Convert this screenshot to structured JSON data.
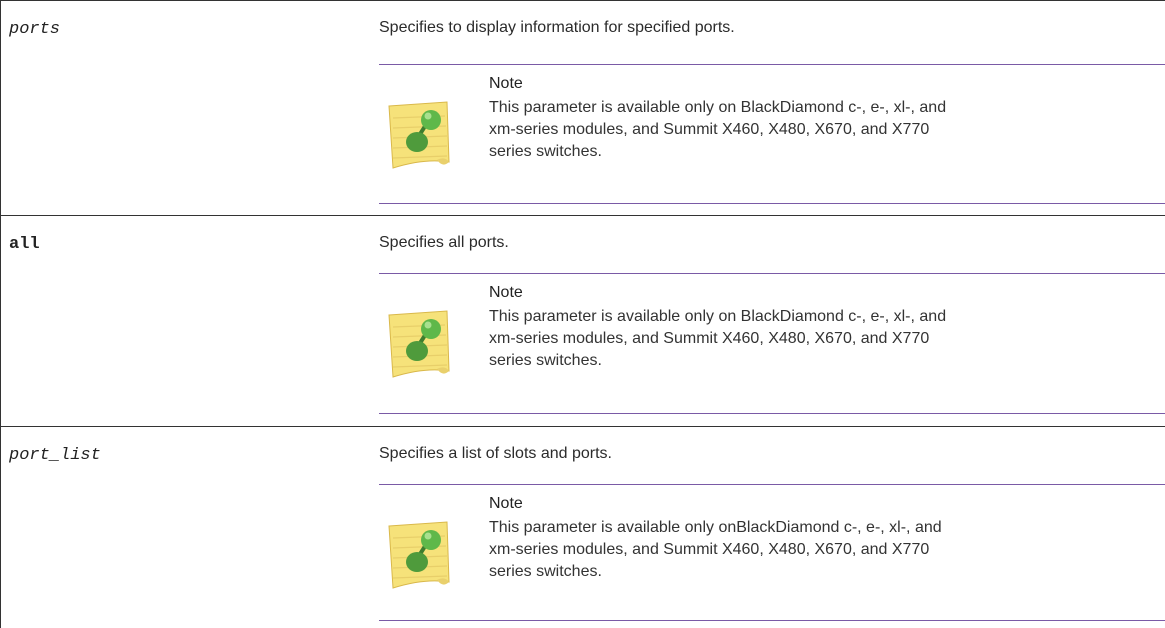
{
  "rows": [
    {
      "term": "ports",
      "description": "Specifies to display information for specified ports.",
      "note_title": "Note",
      "note_lines": [
        "This parameter is available only on BlackDiamond c-, e-, xl-, and",
        "xm-series modules, and Summit X460, X480, X670, and X770",
        "series switches."
      ]
    },
    {
      "term": "all",
      "description": "Specifies all ports.",
      "note_title": "Note",
      "note_lines": [
        "This parameter is available only on BlackDiamond c-, e-, xl-, and",
        "xm-series modules, and Summit X460, X480, X670, and X770",
        "series switches."
      ]
    },
    {
      "term": "port_list",
      "description": "Specifies a list of slots and ports.",
      "note_title": "Note",
      "note_lines": [
        "This parameter is available only onBlackDiamond c-, e-, xl-, and",
        "xm-series modules, and Summit X460, X480, X670, and X770",
        "series switches."
      ]
    }
  ],
  "colors": {
    "note_rule": "#7a5aa6",
    "table_border": "#333333",
    "note_paper": "#f6e27a",
    "pin_green": "#5fb84a"
  },
  "icons": {
    "note": "note-pin-icon"
  }
}
